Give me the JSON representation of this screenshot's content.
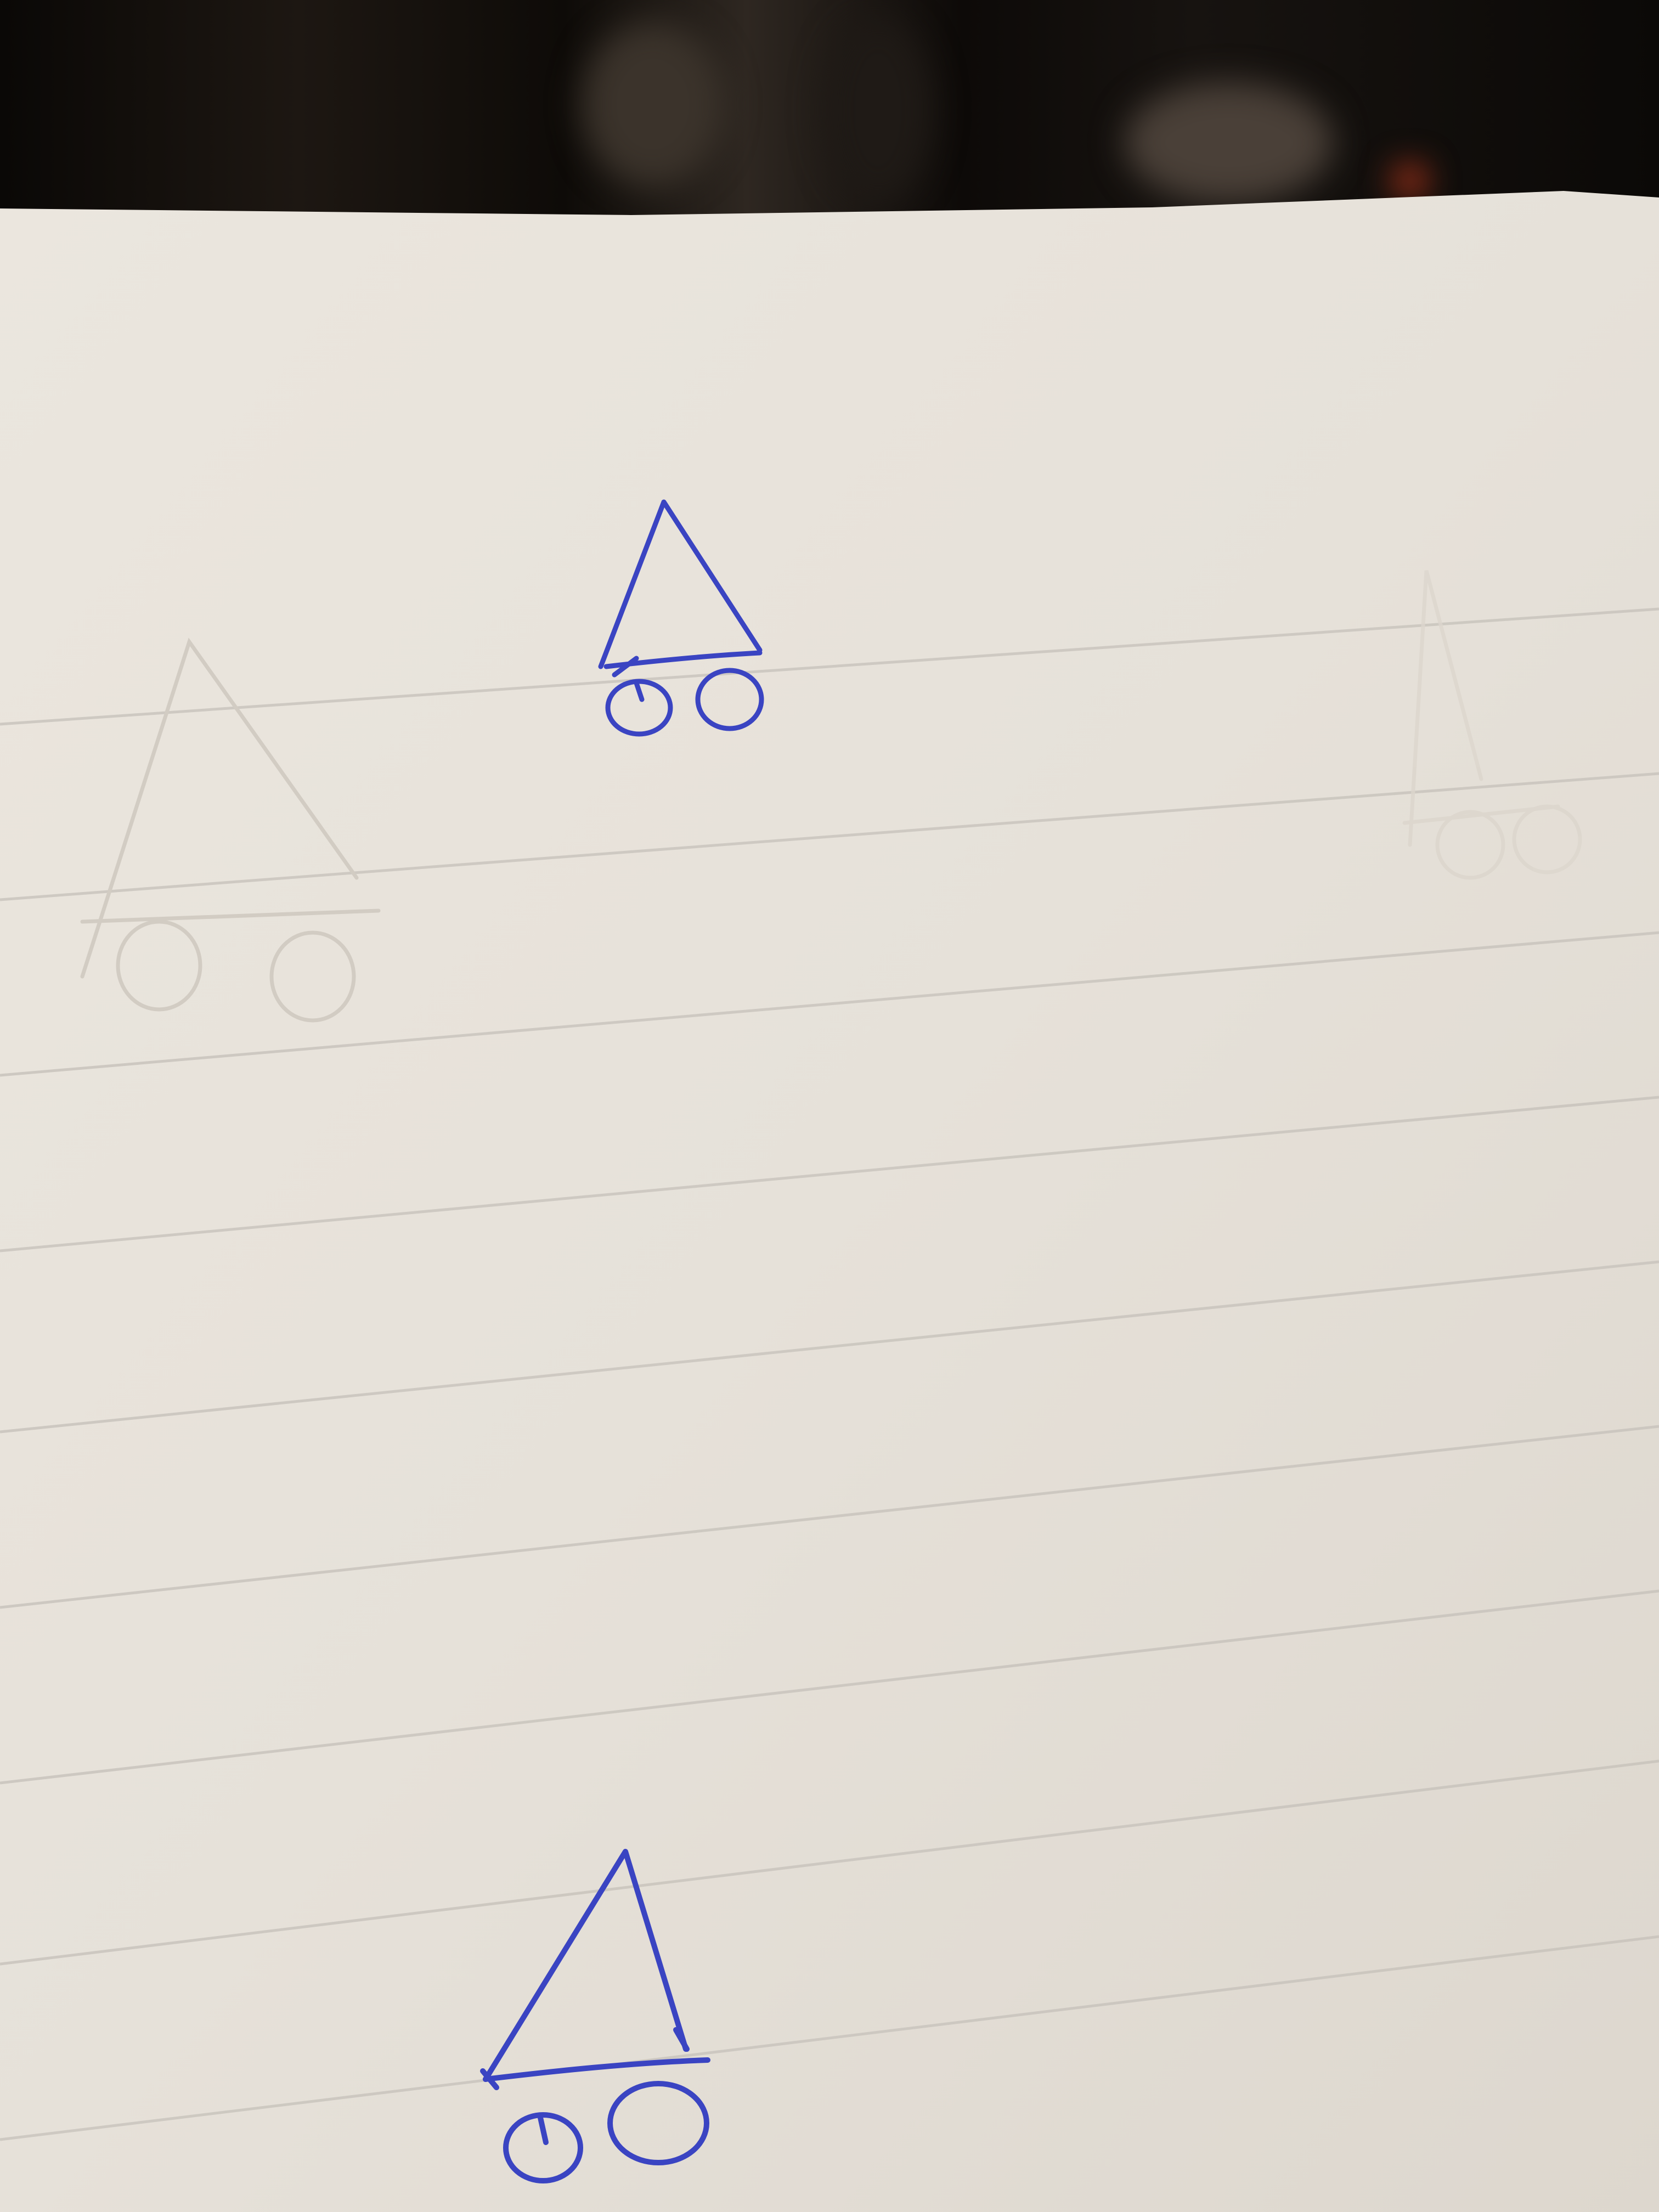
{
  "scene": {
    "description_icon": "paper-sheet",
    "colors": {
      "paper": "#e9e4dc",
      "paper_shadow": "#d9d3ca",
      "rule_line": "#c9c4bd",
      "ink": "#3a44c2",
      "ghost_ink": "#d3cdc4",
      "background": "#0d0b09"
    }
  },
  "drawings": [
    {
      "kind": "cone-with-wheels",
      "ink": "pen"
    },
    {
      "kind": "cone-with-wheels",
      "ink": "pen"
    },
    {
      "kind": "cone-with-wheels",
      "ink": "faint-pencil"
    },
    {
      "kind": "cone-with-wheels",
      "ink": "faint-pencil"
    }
  ]
}
